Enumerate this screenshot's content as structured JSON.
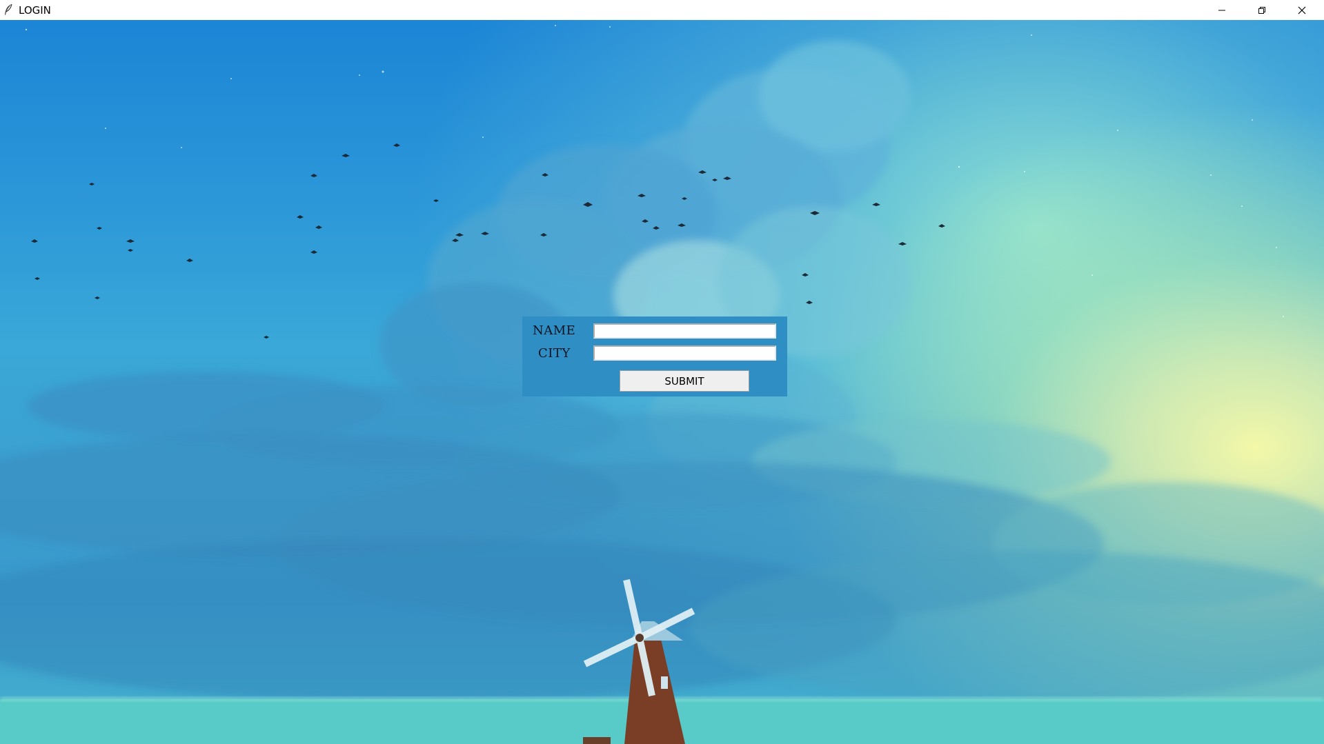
{
  "window": {
    "title": "LOGIN"
  },
  "icons": {
    "app": "feather-icon",
    "minimize": "minimize-icon",
    "maximize": "restore-icon",
    "close": "close-icon"
  },
  "form": {
    "name_label": "NAME",
    "name_value": "",
    "city_label": "CITY",
    "city_value": "",
    "submit_label": "SUBMIT"
  },
  "colors": {
    "panel": "#2f8fc4",
    "sky_top": "#1c85d6",
    "sky_glow": "#f3f8a8"
  }
}
